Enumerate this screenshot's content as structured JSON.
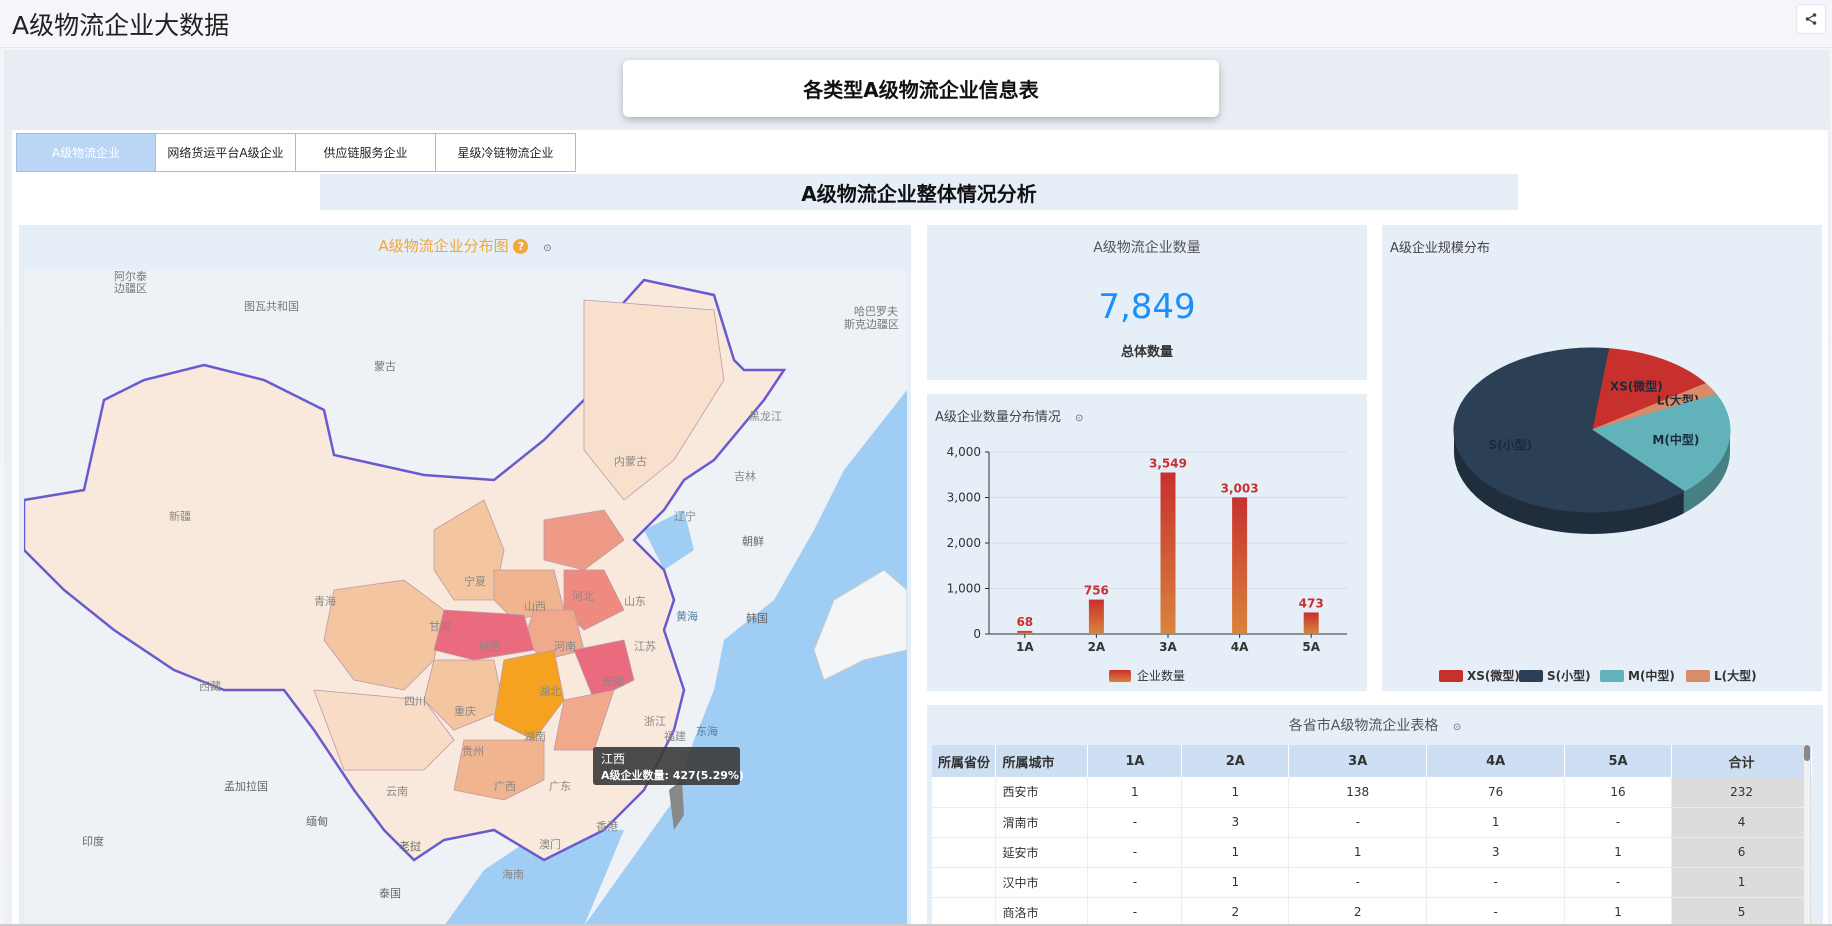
{
  "app": {
    "title": "A级物流企业大数据"
  },
  "header": {
    "title": "各类型A级物流企业信息表"
  },
  "tabs": [
    {
      "label": "A级物流企业",
      "active": true
    },
    {
      "label": "网络货运平台A级企业",
      "active": false
    },
    {
      "label": "供应链服务企业",
      "active": false
    },
    {
      "label": "星级冷链物流企业",
      "active": false
    }
  ],
  "section": {
    "title": "A级物流企业整体情况分析"
  },
  "map": {
    "title": "A级物流企业分布图",
    "help_icon": "?",
    "info_icon": "⊙",
    "tooltip": {
      "region": "江西",
      "text": "A级企业数量: 427(5.29%)"
    },
    "labels": [
      {
        "text": "阿尔泰",
        "kind": "foreign"
      },
      {
        "text": "边疆区",
        "kind": "foreign"
      },
      {
        "text": "图瓦共和国",
        "kind": "foreign"
      },
      {
        "text": "蒙古",
        "kind": "foreign"
      },
      {
        "text": "哈巴罗夫",
        "kind": "foreign"
      },
      {
        "text": "斯克边疆区",
        "kind": "foreign"
      },
      {
        "text": "黑龙江",
        "kind": "prov"
      },
      {
        "text": "吉林",
        "kind": "prov"
      },
      {
        "text": "辽宁",
        "kind": "prov"
      },
      {
        "text": "内蒙古",
        "kind": "prov"
      },
      {
        "text": "新疆",
        "kind": "prov"
      },
      {
        "text": "青海",
        "kind": "prov"
      },
      {
        "text": "西藏",
        "kind": "prov"
      },
      {
        "text": "甘肃",
        "kind": "prov"
      },
      {
        "text": "宁夏",
        "kind": "prov"
      },
      {
        "text": "陕西",
        "kind": "prov"
      },
      {
        "text": "山西",
        "kind": "prov"
      },
      {
        "text": "河北",
        "kind": "prov"
      },
      {
        "text": "山东",
        "kind": "prov"
      },
      {
        "text": "河南",
        "kind": "prov"
      },
      {
        "text": "江苏",
        "kind": "prov"
      },
      {
        "text": "安徽",
        "kind": "prov"
      },
      {
        "text": "湖北",
        "kind": "prov"
      },
      {
        "text": "四川",
        "kind": "prov"
      },
      {
        "text": "重庆",
        "kind": "prov"
      },
      {
        "text": "湖南",
        "kind": "prov"
      },
      {
        "text": "浙江",
        "kind": "prov"
      },
      {
        "text": "贵州",
        "kind": "prov"
      },
      {
        "text": "云南",
        "kind": "prov"
      },
      {
        "text": "广西",
        "kind": "prov"
      },
      {
        "text": "广东",
        "kind": "prov"
      },
      {
        "text": "福建",
        "kind": "prov"
      },
      {
        "text": "澳门",
        "kind": "prov"
      },
      {
        "text": "香港",
        "kind": "prov"
      },
      {
        "text": "海南",
        "kind": "prov"
      },
      {
        "text": "朝鲜",
        "kind": "foreign"
      },
      {
        "text": "韩国",
        "kind": "foreign"
      },
      {
        "text": "黄海",
        "kind": "sea"
      },
      {
        "text": "东海",
        "kind": "sea"
      },
      {
        "text": "孟加拉国",
        "kind": "foreign"
      },
      {
        "text": "缅甸",
        "kind": "foreign"
      },
      {
        "text": "印度",
        "kind": "foreign"
      },
      {
        "text": "老挝",
        "kind": "foreign"
      },
      {
        "text": "泰国",
        "kind": "foreign"
      }
    ]
  },
  "count": {
    "title": "A级物流企业数量",
    "value": "7,849",
    "subtitle": "总体数量"
  },
  "bar_chart": {
    "title": "A级企业数量分布情况",
    "info_icon": "⊙"
  },
  "pie_chart": {
    "title": "A级企业规模分布"
  },
  "table": {
    "title": "各省市A级物流企业表格",
    "info_icon": "⊙",
    "columns": [
      "所属省份",
      "所属城市",
      "1A",
      "2A",
      "3A",
      "4A",
      "5A",
      "合计"
    ],
    "rows": [
      [
        "",
        "西安市",
        "1",
        "1",
        "138",
        "76",
        "16",
        "232"
      ],
      [
        "",
        "渭南市",
        "-",
        "3",
        "-",
        "1",
        "-",
        "4"
      ],
      [
        "",
        "延安市",
        "-",
        "1",
        "1",
        "3",
        "1",
        "6"
      ],
      [
        "",
        "汉中市",
        "-",
        "1",
        "-",
        "-",
        "-",
        "1"
      ],
      [
        "",
        "商洛市",
        "-",
        "2",
        "2",
        "-",
        "1",
        "5"
      ]
    ]
  },
  "chart_data": [
    {
      "type": "bar",
      "categories": [
        "1A",
        "2A",
        "3A",
        "4A",
        "5A"
      ],
      "series": [
        {
          "name": "企业数量",
          "values": [
            68,
            756,
            3549,
            3003,
            473
          ]
        }
      ],
      "yticks": [
        "0",
        "1,000",
        "2,000",
        "3,000",
        "4,000"
      ],
      "ylim": [
        0,
        4000
      ],
      "data_labels": [
        "68",
        "756",
        "3,549",
        "3,003",
        "473"
      ],
      "colors": {
        "bar_top": "#c8302e",
        "bar_bottom": "#d9843c",
        "label": "#c8302e"
      },
      "legend_position": "bottom"
    },
    {
      "type": "pie",
      "slices": [
        {
          "name": "XS(微型)",
          "value": 13.5,
          "color": "#c8302e"
        },
        {
          "name": "L(大型)",
          "value": 2.5,
          "color": "#d98b6a"
        },
        {
          "name": "M(中型)",
          "value": 20.5,
          "color": "#61b2b9"
        },
        {
          "name": "S(小型)",
          "value": 63.5,
          "color": "#2b3f55"
        }
      ],
      "legend_position": "bottom"
    }
  ]
}
